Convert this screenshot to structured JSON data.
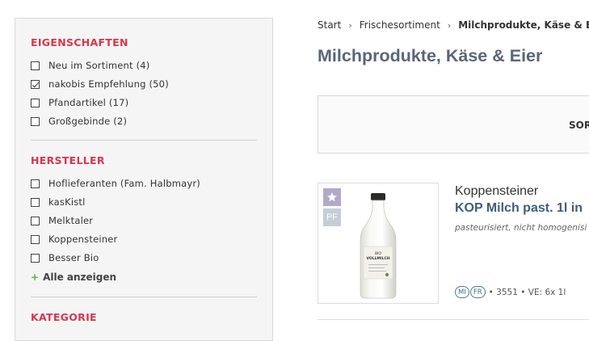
{
  "sidebar": {
    "properties": {
      "title": "EIGENSCHAFTEN",
      "items": [
        {
          "label": "Neu im Sortiment (4)",
          "checked": false
        },
        {
          "label": "nakobis Empfehlung (50)",
          "checked": true
        },
        {
          "label": "Pfandartikel (17)",
          "checked": false
        },
        {
          "label": "Großgebinde (2)",
          "checked": false
        }
      ]
    },
    "manufacturer": {
      "title": "HERSTELLER",
      "items": [
        {
          "label": "Hoflieferanten (Fam. Halbmayr)",
          "checked": false
        },
        {
          "label": "kasKistl",
          "checked": false
        },
        {
          "label": "Melktaler",
          "checked": false
        },
        {
          "label": "Koppensteiner",
          "checked": false
        },
        {
          "label": "Besser Bio",
          "checked": false
        }
      ],
      "show_all_label": "Alle anzeigen",
      "show_all_prefix": "+"
    },
    "category": {
      "title": "KATEGORIE"
    }
  },
  "breadcrumb": {
    "items": [
      "Start",
      "Frischesortiment",
      "Milchprodukte, Käse & Eier"
    ],
    "separator": "›"
  },
  "page_title": "Milchprodukte, Käse & Eier",
  "sort": {
    "label": "SOR"
  },
  "product": {
    "vendor": "Koppensteiner",
    "name": "KOP Milch past. 1l in",
    "description": "pasteurisiert, nicht homogenisi",
    "badges": {
      "star_icon": "star-icon",
      "pf": "PF"
    },
    "tags": [
      "MI",
      "FR"
    ],
    "meta": "• 3551 • VE: 6x 1l",
    "bottle_label": [
      "BIO",
      "VOLLMILCH"
    ]
  },
  "colors": {
    "accent_red": "#d9364f",
    "title_blue": "#5a6678",
    "link_blue": "#3f5e7a",
    "badge_star": "#b4a9c8",
    "badge_pf": "#c5ced8"
  }
}
